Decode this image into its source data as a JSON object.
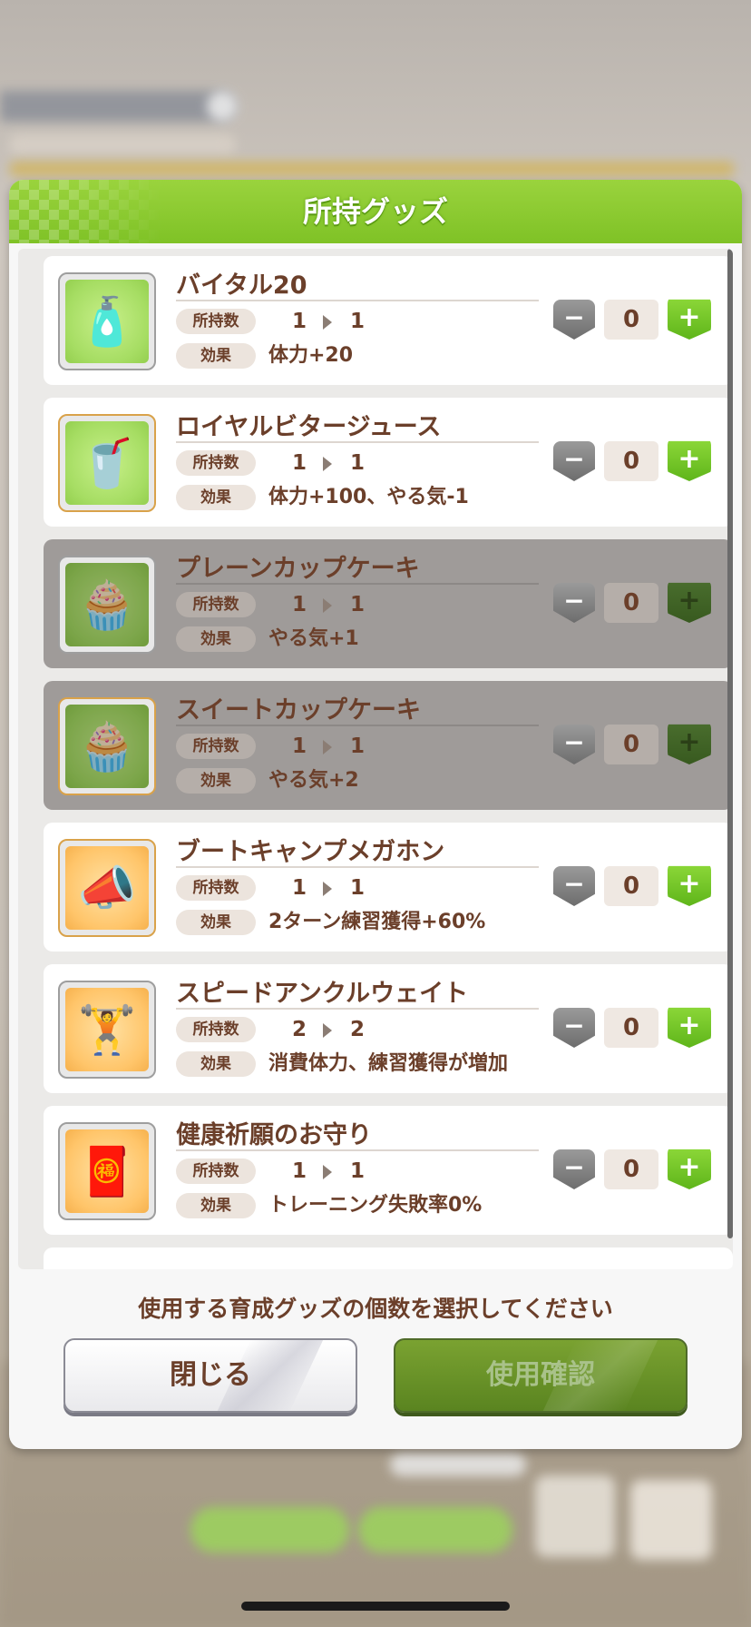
{
  "dialog": {
    "title": "所持グッズ",
    "instruction": "使用する育成グッズの個数を選択してください",
    "close_label": "閉じる",
    "confirm_label": "使用確認"
  },
  "labels": {
    "owned": "所持数",
    "effect": "効果"
  },
  "items": [
    {
      "name": "バイタル20",
      "owned_from": "1",
      "owned_to": "1",
      "effect": "体力+20",
      "count": "0",
      "minus": "−",
      "plus": "+",
      "icon": "drink-bottle-icon",
      "icon_glyph": "🧴",
      "disabled": false
    },
    {
      "name": "ロイヤルビタージュース",
      "owned_from": "1",
      "owned_to": "1",
      "effect": "体力+100、やる気-1",
      "count": "0",
      "minus": "−",
      "plus": "+",
      "icon": "green-juice-glass-icon",
      "icon_glyph": "🥤",
      "disabled": false
    },
    {
      "name": "プレーンカップケーキ",
      "owned_from": "1",
      "owned_to": "1",
      "effect": "やる気+1",
      "count": "0",
      "minus": "−",
      "plus": "+",
      "icon": "plain-cupcake-icon",
      "icon_glyph": "🧁",
      "disabled": true
    },
    {
      "name": "スイートカップケーキ",
      "owned_from": "1",
      "owned_to": "1",
      "effect": "やる気+2",
      "count": "0",
      "minus": "−",
      "plus": "+",
      "icon": "sweet-cupcake-icon",
      "icon_glyph": "🧁",
      "disabled": true
    },
    {
      "name": "ブートキャンプメガホン",
      "owned_from": "1",
      "owned_to": "1",
      "effect": "2ターン練習獲得+60%",
      "count": "0",
      "minus": "−",
      "plus": "+",
      "icon": "megaphone-icon",
      "icon_glyph": "📣",
      "disabled": false
    },
    {
      "name": "スピードアンクルウェイト",
      "owned_from": "2",
      "owned_to": "2",
      "effect": "消費体力、練習獲得が増加",
      "count": "0",
      "minus": "−",
      "plus": "+",
      "icon": "ankle-weight-icon",
      "icon_glyph": "🏋",
      "disabled": false
    },
    {
      "name": "健康祈願のお守り",
      "owned_from": "1",
      "owned_to": "1",
      "effect": "トレーニング失敗率0%",
      "count": "0",
      "minus": "−",
      "plus": "+",
      "icon": "charm-amulet-icon",
      "icon_glyph": "🧧",
      "disabled": false
    }
  ]
}
